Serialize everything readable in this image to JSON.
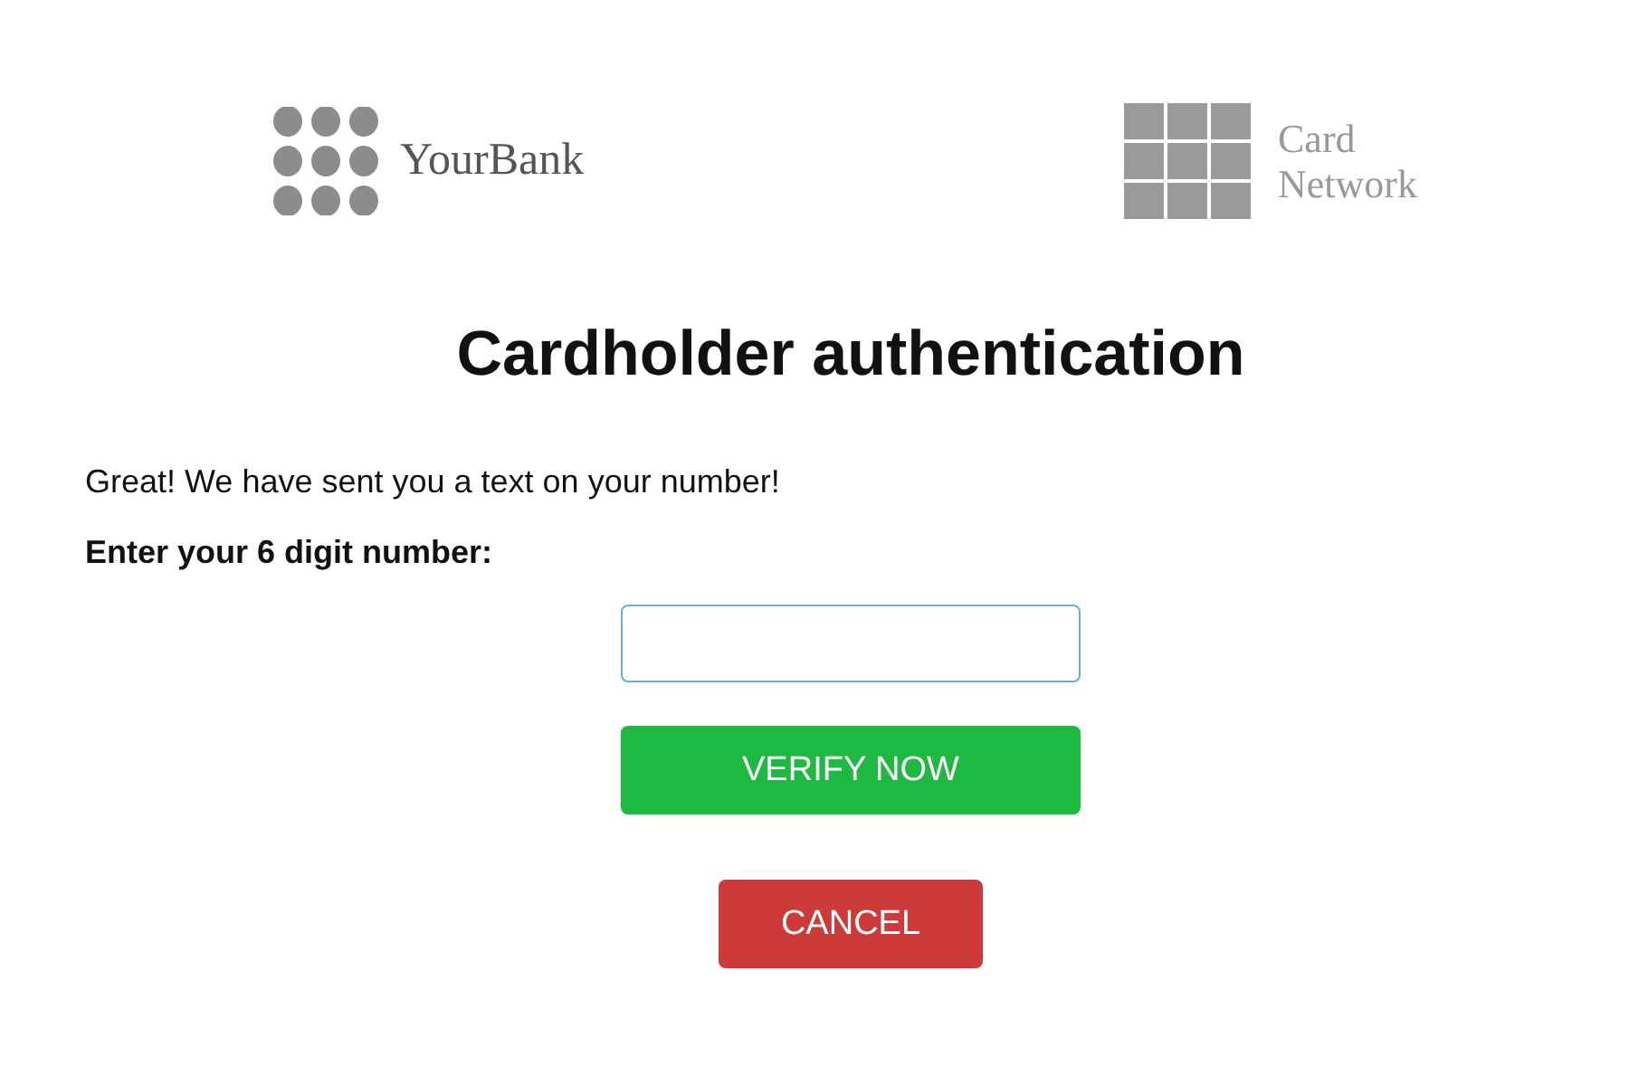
{
  "header": {
    "bank_name": "YourBank",
    "network_name": "Card Network"
  },
  "title": "Cardholder authentication",
  "message": "Great! We have sent you a text on your number!",
  "code_field": {
    "label": "Enter your 6 digit number:"
  },
  "buttons": [
    {
      "kind": "primary",
      "label": "VERIFY NOW"
    },
    {
      "kind": "danger",
      "label": "CANCEL"
    }
  ]
}
